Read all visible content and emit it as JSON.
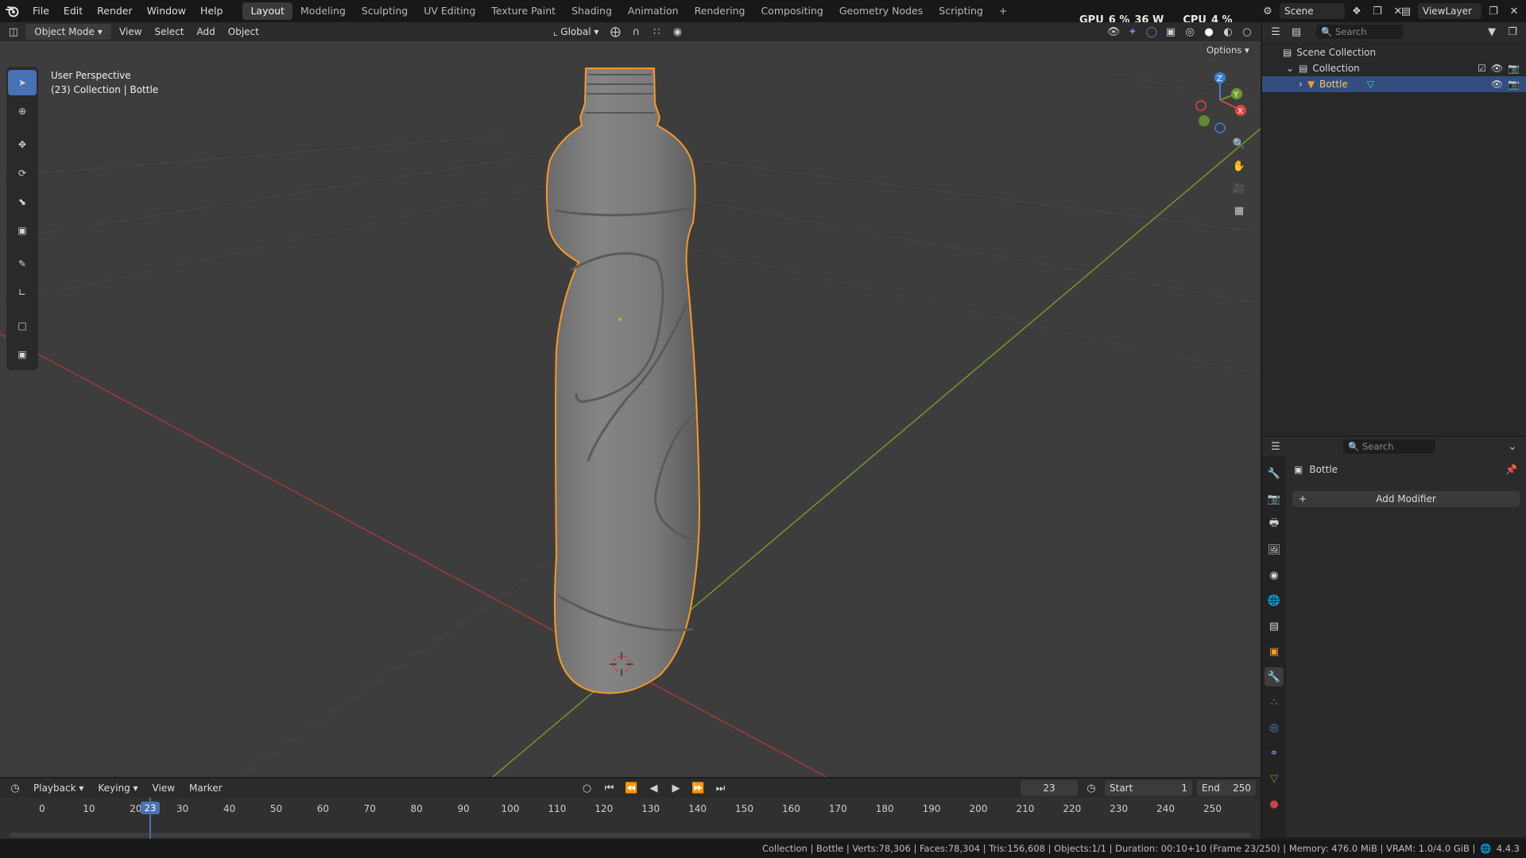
{
  "app": {
    "logo": "blender-icon"
  },
  "menus": [
    "File",
    "Edit",
    "Render",
    "Window",
    "Help"
  ],
  "workspaces": [
    "Layout",
    "Modeling",
    "Sculpting",
    "UV Editing",
    "Texture Paint",
    "Shading",
    "Animation",
    "Rendering",
    "Compositing",
    "Geometry Nodes",
    "Scripting"
  ],
  "active_workspace": "Layout",
  "add_workspace": "+",
  "stats_top": {
    "gpu_label": "GPU",
    "gpu_value": "6 %",
    "power": "36 W",
    "cpu_label": "CPU",
    "cpu_value": "4 %"
  },
  "scene": {
    "name": "Scene",
    "viewlayer": "ViewLayer"
  },
  "viewport_header": {
    "mode": "Object Mode",
    "view": "View",
    "select": "Select",
    "add": "Add",
    "object": "Object",
    "orientation": "Global",
    "options": "Options"
  },
  "viewport": {
    "perspective": "User Perspective",
    "context": "(23) Collection | Bottle",
    "gizmo_axes": {
      "z": "Z",
      "y": "Y",
      "x": "X"
    }
  },
  "outliner": {
    "search_placeholder": "Search",
    "items": [
      {
        "label": "Scene Collection",
        "level": 0
      },
      {
        "label": "Collection",
        "level": 1
      },
      {
        "label": "Bottle",
        "level": 2,
        "selected": true
      }
    ]
  },
  "properties": {
    "search_placeholder": "Search",
    "object_name": "Bottle",
    "add_modifier": "Add Modifier",
    "add_symbol": "+"
  },
  "timeline": {
    "menus": [
      "Playback",
      "Keying",
      "View",
      "Marker"
    ],
    "current_frame": "23",
    "start_label": "Start",
    "start": "1",
    "end_label": "End",
    "end": "250",
    "ticks": [
      "0",
      "10",
      "20",
      "30",
      "40",
      "50",
      "60",
      "70",
      "80",
      "90",
      "100",
      "110",
      "120",
      "130",
      "140",
      "150",
      "160",
      "170",
      "180",
      "190",
      "200",
      "210",
      "220",
      "230",
      "240",
      "250"
    ],
    "playhead": "23"
  },
  "statusbar": {
    "text": "Collection | Bottle | Verts:78,306 | Faces:78,304 | Tris:156,608 | Objects:1/1 | Duration: 00:10+10 (Frame 23/250) | Memory: 476.0 MiB | VRAM: 1.0/4.0 GiB |",
    "version": "4.4.3"
  },
  "colors": {
    "accent": "#4772b3",
    "selection_outline": "#f39a2b",
    "axis_x": "#a33a3a",
    "axis_y": "#6f9a2e",
    "axis_z": "#3f7fd6",
    "viewport_bg": "#3d3d3d"
  }
}
